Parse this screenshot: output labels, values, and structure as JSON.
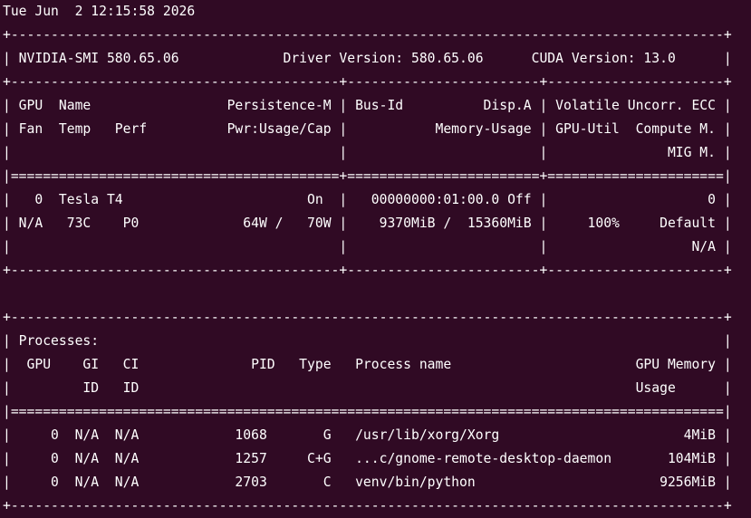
{
  "terminal": {
    "colors": {
      "background": "#300a24",
      "foreground": "#ffffff"
    },
    "timestamp": "Tue Jun  2 12:15:58 2026",
    "header": {
      "nvidia_smi": "NVIDIA-SMI 580.65.06",
      "driver": "Driver Version: 580.65.06",
      "cuda": "CUDA Version: 13.0"
    },
    "gpu_columns": {
      "row1": [
        "GPU",
        "Name",
        "Persistence-M",
        "Bus-Id",
        "Disp.A",
        "Volatile Uncorr. ECC"
      ],
      "row2": [
        "Fan",
        "Temp",
        "Perf",
        "Pwr:Usage/Cap",
        "Memory-Usage",
        "GPU-Util",
        "Compute M."
      ],
      "row3": [
        "MIG M."
      ]
    },
    "gpus": [
      {
        "index": "0",
        "name": "Tesla T4",
        "persistence": "On",
        "bus_id": "00000000:01:00.0",
        "disp": "Off",
        "ecc": "0",
        "fan": "N/A",
        "temp": "73C",
        "perf": "P0",
        "power": "64W /   70W",
        "memory": "9370MiB /  15360MiB",
        "util": "100%",
        "compute_mode": "Default",
        "mig": "N/A"
      }
    ],
    "processes": {
      "title": "Processes:",
      "columns_row1": [
        "GPU",
        "GI",
        "CI",
        "PID",
        "Type",
        "Process name",
        "GPU Memory"
      ],
      "columns_row2": [
        "ID",
        "ID",
        "Usage"
      ],
      "rows": [
        {
          "gpu": "0",
          "gi": "N/A",
          "ci": "N/A",
          "pid": "1068",
          "type": "G",
          "name": "/usr/lib/xorg/Xorg",
          "memory": "4MiB"
        },
        {
          "gpu": "0",
          "gi": "N/A",
          "ci": "N/A",
          "pid": "1257",
          "type": "C+G",
          "name": "...c/gnome-remote-desktop-daemon",
          "memory": "104MiB"
        },
        {
          "gpu": "0",
          "gi": "N/A",
          "ci": "N/A",
          "pid": "2703",
          "type": "C",
          "name": "venv/bin/python",
          "memory": "9256MiB"
        }
      ]
    }
  }
}
